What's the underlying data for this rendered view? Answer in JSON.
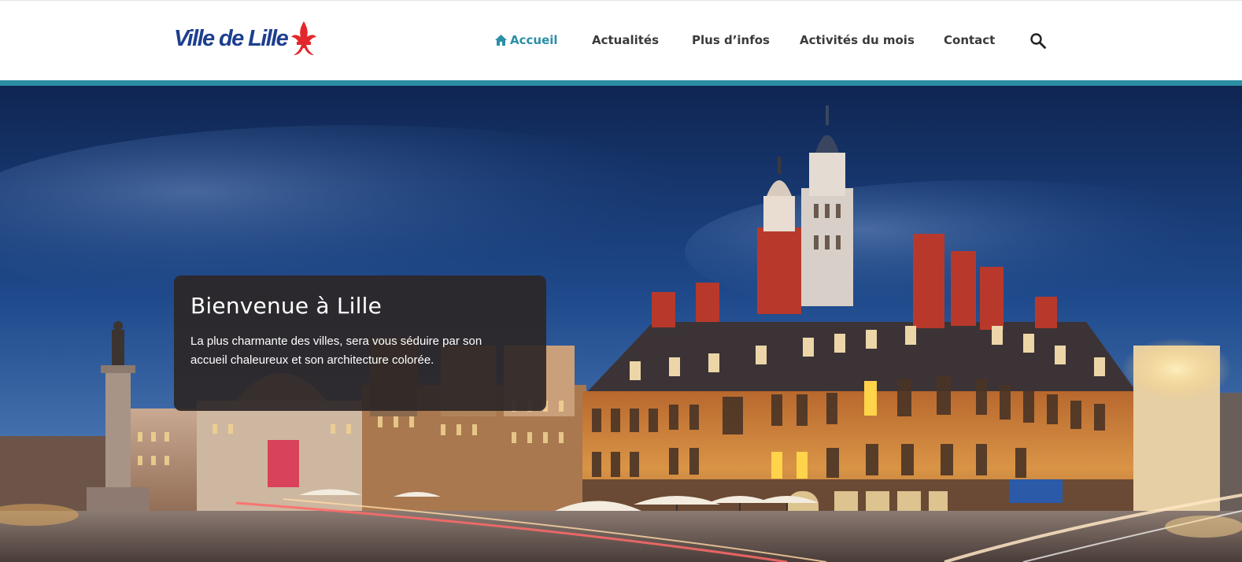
{
  "header": {
    "logo_text": "Ville de Lille",
    "logo_icon": "fleur-de-lys-icon",
    "nav": [
      {
        "label": "Accueil",
        "icon": "home-icon",
        "active": true
      },
      {
        "label": "Actualités"
      },
      {
        "label": "Plus d’infos"
      },
      {
        "label": "Activités du mois"
      },
      {
        "label": "Contact"
      }
    ],
    "search_icon": "search-icon"
  },
  "hero": {
    "title": "Bienvenue à Lille",
    "text": "La plus charmante des villes, sera vous séduire par son accueil chaleureux et son architecture colorée."
  },
  "colors": {
    "accent": "#2c8ea2",
    "active_nav": "#2b8fa8",
    "logo_blue": "#1d3f8f",
    "logo_red": "#e3262c",
    "nav_text": "#3a3a3a",
    "card_bg": "#2d2626"
  }
}
